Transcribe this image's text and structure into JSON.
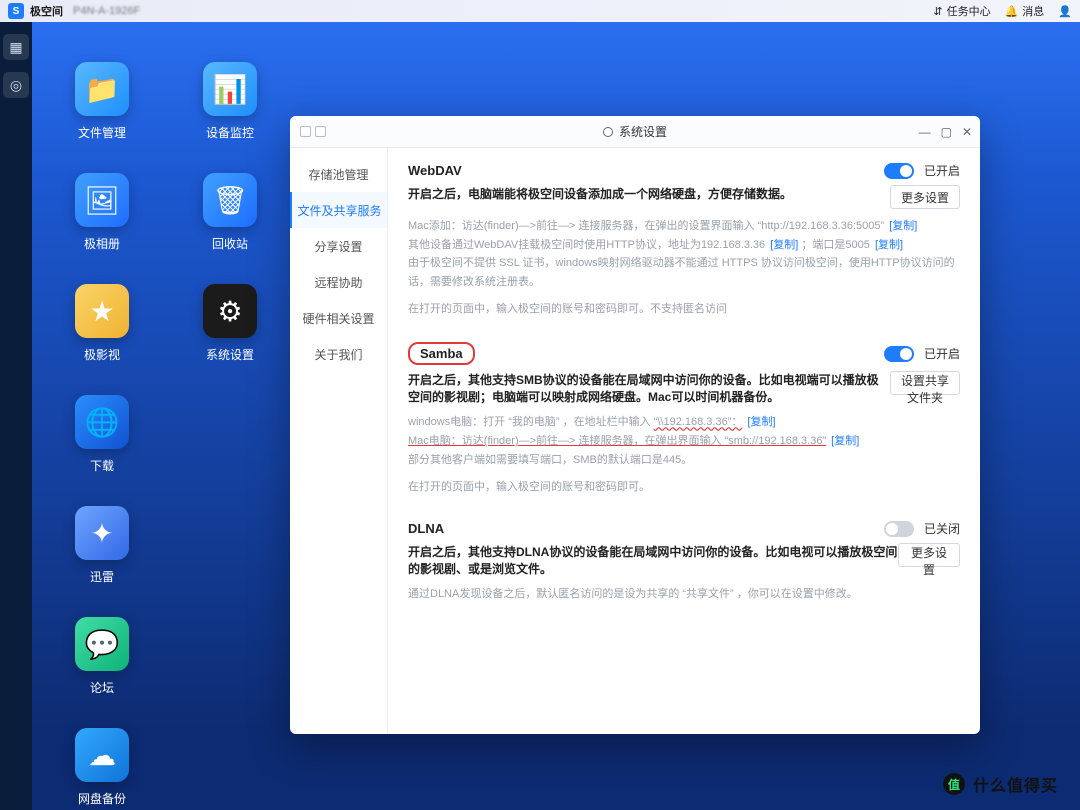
{
  "topbar": {
    "brand": "极空间",
    "device": "P4N-A-1926F",
    "task_center": "任务中心",
    "messages": "消息"
  },
  "desktop_icons_col1": [
    {
      "label": "文件管理",
      "name": "file-manager-icon",
      "cls": "c-blue",
      "glyph": "📁"
    },
    {
      "label": "极相册",
      "name": "album-icon",
      "cls": "c-blue2",
      "glyph": "🖼"
    },
    {
      "label": "极影视",
      "name": "video-icon",
      "cls": "c-gold",
      "glyph": "★"
    },
    {
      "label": "下载",
      "name": "download-icon",
      "cls": "c-globe",
      "glyph": "🌐"
    },
    {
      "label": "迅雷",
      "name": "thunder-icon",
      "cls": "c-sw",
      "glyph": "✦"
    },
    {
      "label": "论坛",
      "name": "forum-icon",
      "cls": "c-chat",
      "glyph": "💬"
    },
    {
      "label": "网盘备份",
      "name": "cloud-backup-icon",
      "cls": "c-cloud",
      "glyph": "☁"
    }
  ],
  "desktop_icons_col2": [
    {
      "label": "设备监控",
      "name": "monitor-icon",
      "cls": "c-blue",
      "glyph": "📊"
    },
    {
      "label": "回收站",
      "name": "trash-icon",
      "cls": "c-blue2",
      "glyph": "🗑"
    },
    {
      "label": "系统设置",
      "name": "settings-icon",
      "cls": "c-dark",
      "glyph": "⚙"
    }
  ],
  "dialog": {
    "title": "系统设置",
    "side": [
      {
        "label": "存储池管理",
        "name": "side-storage"
      },
      {
        "label": "文件及共享服务",
        "name": "side-share",
        "active": true
      },
      {
        "label": "分享设置",
        "name": "side-share-settings"
      },
      {
        "label": "远程协助",
        "name": "side-remote"
      },
      {
        "label": "硬件相关设置",
        "name": "side-hardware"
      },
      {
        "label": "关于我们",
        "name": "side-about"
      }
    ],
    "sections": {
      "webdav": {
        "title": "WebDAV",
        "state": "已开启",
        "on": true,
        "more": "更多设置",
        "desc": "开启之后，电脑端能将极空间设备添加成一个网络硬盘，方便存储数据。",
        "help1_pre": "Mac添加：访达(finder)—>前往—> 连接服务器，在弹出的设置界面输入 “http://192.168.3.36:5005” ",
        "help1_link": "[复制]",
        "help2_pre": "其他设备通过WebDAV挂载极空间时使用HTTP协议，地址为192.168.3.36",
        "help2_link": "[复制]",
        "help2_post": "；端口是5005",
        "help2_link2": "[复制]",
        "help3": "由于极空间不提供 SSL 证书，windows映射网络驱动器不能通过 HTTPS 协议访问极空间，使用HTTP协议访问的话，需要修改系统注册表。",
        "help4": "在打开的页面中，输入极空间的账号和密码即可。不支持匿名访问"
      },
      "samba": {
        "title": "Samba",
        "state": "已开启",
        "on": true,
        "more": "设置共享文件夹",
        "desc": "开启之后，其他支持SMB协议的设备能在局域网中访问你的设备。比如电视端可以播放极空间的影视剧；电脑端可以映射成网络硬盘。Mac可以时间机器备份。",
        "help1_pre": "windows电脑：打开 “我的电脑” ，在地址栏中输入",
        "help1_addr": "“\\\\192.168.3.36”：",
        "help1_link": "[复制]",
        "help2_pre": "Mac电脑：访达(finder)—>前往—> 连接服务器，在弹出界面输入 ",
        "help2_addr": "“smb://192.168.3.36”",
        "help2_link": "[复制]",
        "help3": "部分其他客户端如需要填写端口，SMB的默认端口是445。",
        "help4": "在打开的页面中，输入极空间的账号和密码即可。"
      },
      "dlna": {
        "title": "DLNA",
        "state": "已关闭",
        "on": false,
        "more": "更多设置",
        "desc": "开启之后，其他支持DLNA协议的设备能在局域网中访问你的设备。比如电视可以播放极空间的影视剧、或是浏览文件。",
        "help1": "通过DLNA发现设备之后，默认匿名访问的是设为共享的 “共享文件” ，你可以在设置中修改。"
      }
    }
  },
  "watermark": "什么值得买"
}
